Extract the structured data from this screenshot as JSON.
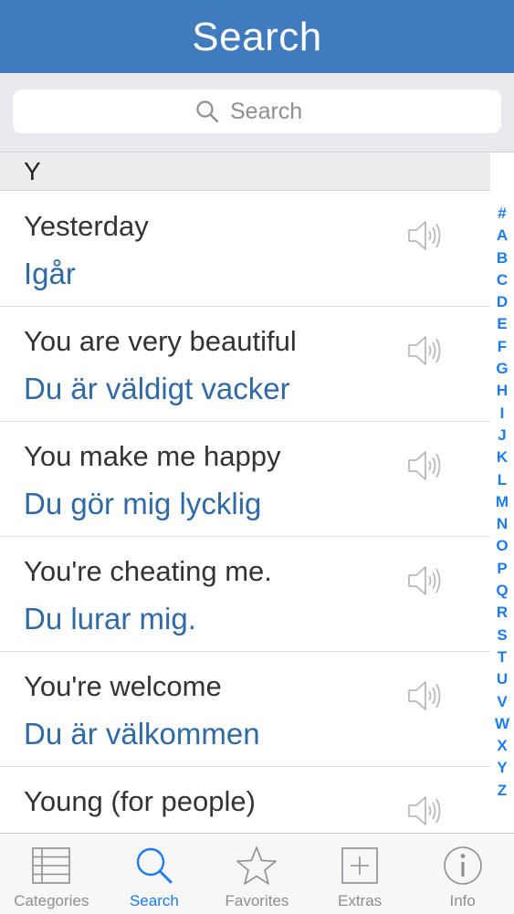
{
  "navbar": {
    "title": "Search"
  },
  "search": {
    "placeholder": "Search"
  },
  "section": {
    "letter": "Y"
  },
  "phrases": [
    {
      "en": "Yesterday",
      "sv": "Igår"
    },
    {
      "en": "You are very beautiful",
      "sv": "Du är väldigt vacker"
    },
    {
      "en": "You make me happy",
      "sv": "Du gör mig lycklig"
    },
    {
      "en": "You're cheating me.",
      "sv": "Du lurar mig."
    },
    {
      "en": "You're welcome",
      "sv": "Du är välkommen"
    },
    {
      "en": "Young (for people)",
      "sv": ""
    }
  ],
  "index": [
    "#",
    "A",
    "B",
    "C",
    "D",
    "E",
    "F",
    "G",
    "H",
    "I",
    "J",
    "K",
    "L",
    "M",
    "N",
    "O",
    "P",
    "Q",
    "R",
    "S",
    "T",
    "U",
    "V",
    "W",
    "X",
    "Y",
    "Z"
  ],
  "tabs": [
    {
      "label": "Categories",
      "icon": "list-icon",
      "active": false
    },
    {
      "label": "Search",
      "icon": "search-icon",
      "active": true
    },
    {
      "label": "Favorites",
      "icon": "star-icon",
      "active": false
    },
    {
      "label": "Extras",
      "icon": "plus-box-icon",
      "active": false
    },
    {
      "label": "Info",
      "icon": "info-icon",
      "active": false
    }
  ],
  "colors": {
    "navbar": "#3f7bbd",
    "accent": "#1b7cf2",
    "translation": "#2f6aa6"
  }
}
